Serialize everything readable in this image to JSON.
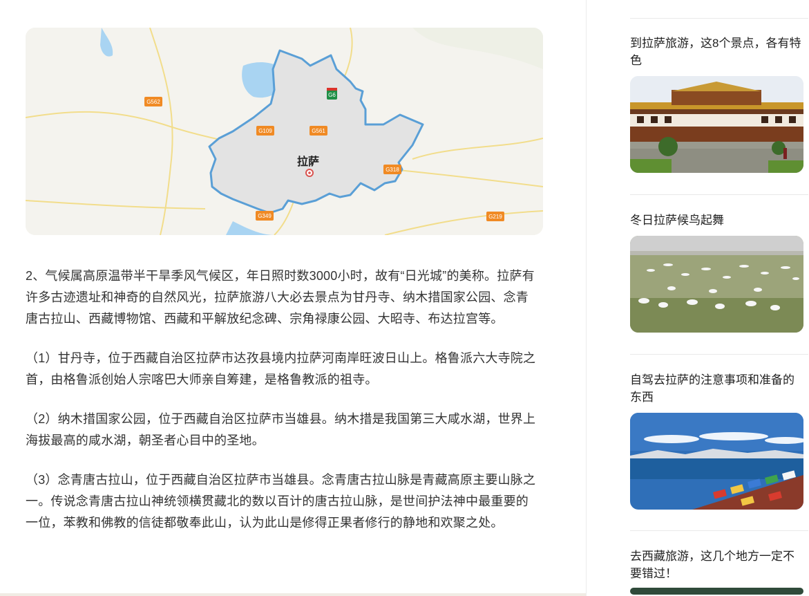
{
  "map": {
    "city_label": "拉萨",
    "road_labels": [
      "G562",
      "G6",
      "G109",
      "G561",
      "G318",
      "G349",
      "G219"
    ]
  },
  "article": {
    "paragraphs": [
      "2、气候属高原温带半干旱季风气候区，年日照时数3000小时，故有“日光城”的美称。拉萨有许多古迹遗址和神奇的自然风光，拉萨旅游八大必去景点为甘丹寺、纳木措国家公园、念青唐古拉山、西藏博物馆、西藏和平解放纪念碑、宗角禄康公园、大昭寺、布达拉宫等。",
      "（1）甘丹寺，位于西藏自治区拉萨市达孜县境内拉萨河南岸旺波日山上。格鲁派六大寺院之首，由格鲁派创始人宗喀巴大师亲自筹建，是格鲁教派的祖寺。",
      "（2）纳木措国家公园，位于西藏自治区拉萨市当雄县。纳木措是我国第三大咸水湖，世界上海拔最高的咸水湖，朝圣者心目中的圣地。",
      "（3）念青唐古拉山，位于西藏自治区拉萨市当雄县。念青唐古拉山脉是青藏高原主要山脉之一。传说念青唐古拉山神统领横贯藏北的数以百计的唐古拉山脉，是世间护法神中最重要的一位，苯教和佛教的信徒都敬奉此山，认为此山是修得正果者修行的静地和欢聚之处。"
    ]
  },
  "sidebar": {
    "items": [
      {
        "title": "到拉萨旅游，这8个景点，各有特色"
      },
      {
        "title": "冬日拉萨候鸟起舞"
      },
      {
        "title": "自驾去拉萨的注意事项和准备的东西"
      },
      {
        "title": "去西藏旅游，这几个地方一定不要错过！"
      }
    ]
  }
}
